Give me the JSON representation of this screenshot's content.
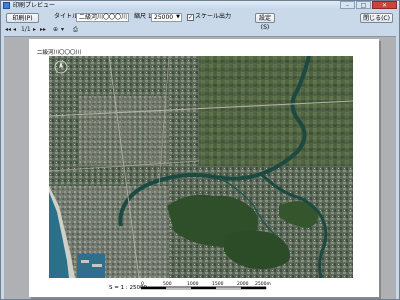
{
  "window": {
    "title": "印刷プレビュー",
    "minimize_label": "–",
    "maximize_label": "□",
    "close_label": "✕"
  },
  "toolbar": {
    "print_label": "印刷(P)",
    "title_label": "タイトル",
    "title_value": "二級河川〇〇〇川",
    "scale_label": "縮尺 1:",
    "scale_value": "25000",
    "scale_output_checked": "✓",
    "scale_output_label": "スケール出力",
    "settings_label": "設定(S)",
    "close_label": "閉じる(C)"
  },
  "nav": {
    "first": "◂◂",
    "prev": "◂",
    "page_indicator": "1/1",
    "next": "▸",
    "last": "▸▸",
    "zoom_icon": "⊕",
    "zoom_dropdown": "▾",
    "print_icon": "⎙"
  },
  "page": {
    "map_title": "二級河川〇〇〇川",
    "scale_text": "S = 1 : 25000",
    "scale_ticks": [
      "0",
      "500",
      "1000",
      "1500",
      "2000",
      "2500m"
    ]
  },
  "colors": {
    "accent": "#3a7fd8",
    "close_red": "#c9453b",
    "window_bg": "#c9d9ea",
    "viewport_bg": "#aeb0b3",
    "river": "#1c4a41",
    "sea": "#2b6f89"
  }
}
